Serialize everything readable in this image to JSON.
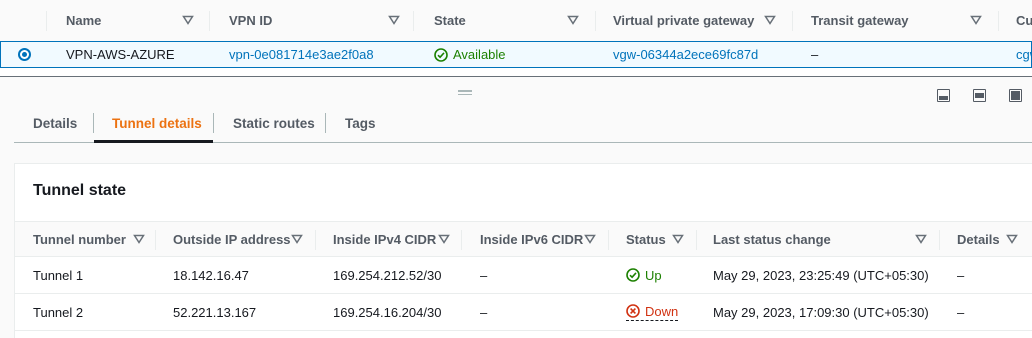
{
  "vpn_table": {
    "columns": [
      {
        "label": "Name"
      },
      {
        "label": "VPN ID"
      },
      {
        "label": "State"
      },
      {
        "label": "Virtual private gateway"
      },
      {
        "label": "Transit gateway"
      },
      {
        "label": "Cu"
      }
    ],
    "selected_row": {
      "name": "VPN-AWS-AZURE",
      "vpn_id": "vpn-0e081714e3ae2f0a8",
      "state": "Available",
      "vgw": "vgw-06344a2ece69fc87d",
      "transit_gateway": "–",
      "customer_gateway": "cgw"
    }
  },
  "split_panel": {
    "tabs": [
      {
        "label": "Details"
      },
      {
        "label": "Tunnel details"
      },
      {
        "label": "Static routes"
      },
      {
        "label": "Tags"
      }
    ],
    "active_tab": "Tunnel details"
  },
  "tunnel_state": {
    "title": "Tunnel state",
    "columns": [
      {
        "label": "Tunnel number"
      },
      {
        "label": "Outside IP address"
      },
      {
        "label": "Inside IPv4 CIDR"
      },
      {
        "label": "Inside IPv6 CIDR"
      },
      {
        "label": "Status"
      },
      {
        "label": "Last status change"
      },
      {
        "label": "Details"
      }
    ],
    "rows": [
      {
        "tunnel": "Tunnel 1",
        "outside_ip": "18.142.16.47",
        "inside_ipv4": "169.254.212.52/30",
        "inside_ipv6": "–",
        "status": "Up",
        "last_change": "May 29, 2023, 23:25:49 (UTC+05:30)",
        "details": "–"
      },
      {
        "tunnel": "Tunnel 2",
        "outside_ip": "52.221.13.167",
        "inside_ipv4": "169.254.16.204/30",
        "inside_ipv6": "–",
        "status": "Down",
        "last_change": "May 29, 2023, 17:09:30 (UTC+05:30)",
        "details": "–"
      }
    ]
  },
  "colors": {
    "accent": "#0073bb",
    "active_tab": "#ec7211",
    "status_ok": "#1d8102",
    "status_error": "#d13212"
  }
}
